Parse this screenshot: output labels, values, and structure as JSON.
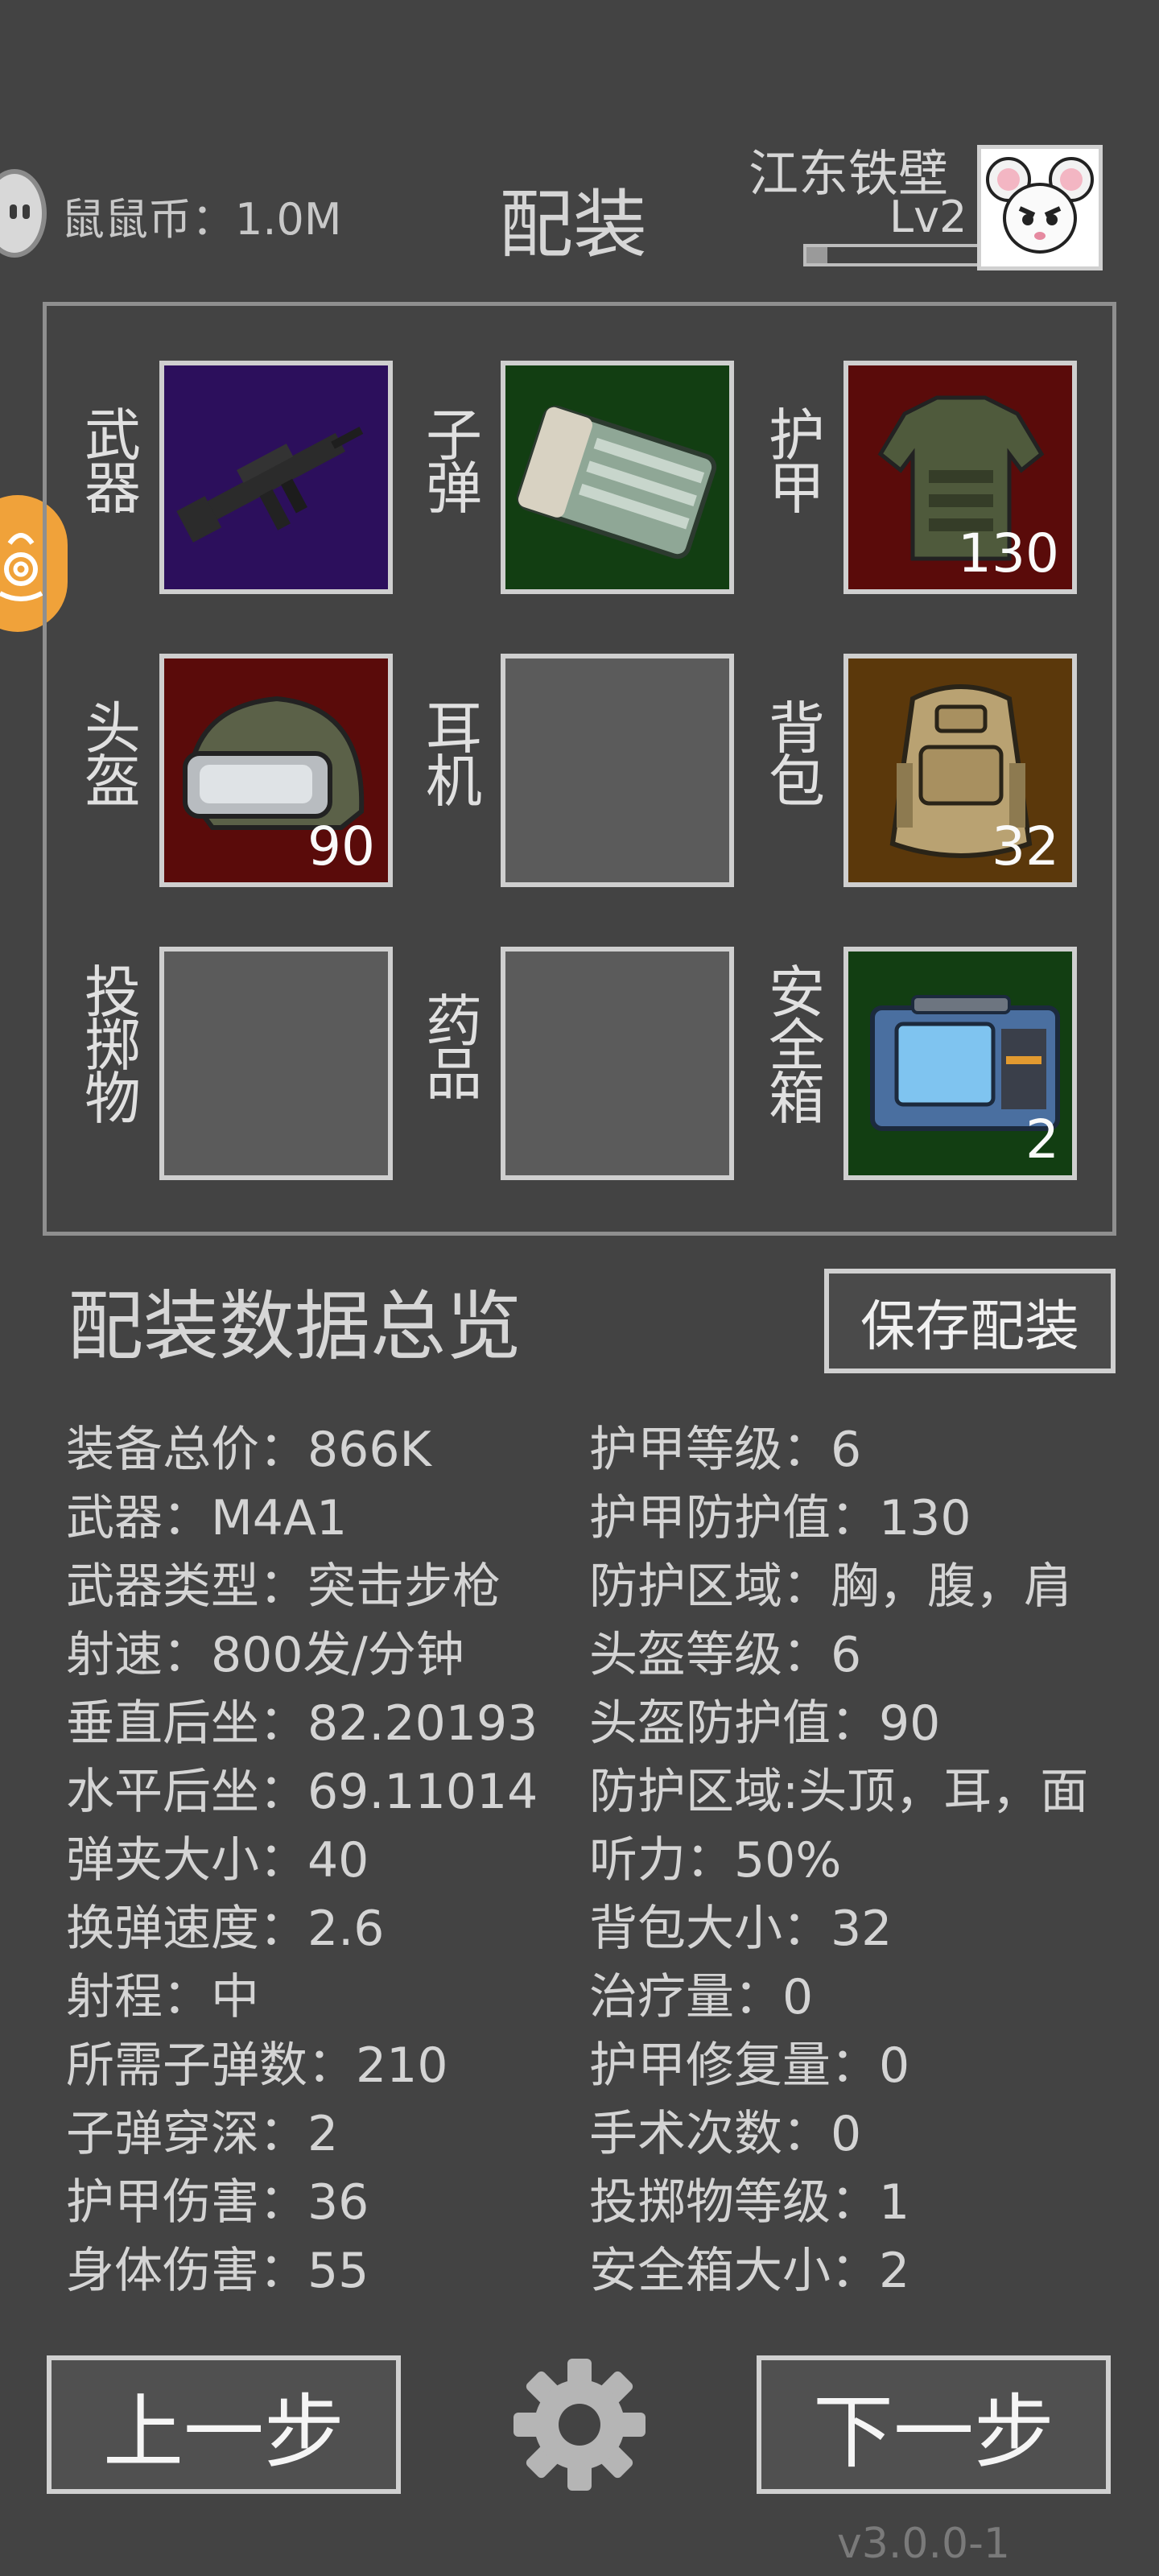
{
  "header": {
    "coins_label": "鼠鼠币：1.0M",
    "title": "配装",
    "username": "江东铁壁",
    "level": "Lv2",
    "xp_progress": 0.12
  },
  "slots": [
    {
      "label": "武器",
      "icon": "rifle-icon",
      "bg": "#2c0f5c",
      "count": ""
    },
    {
      "label": "子弹",
      "icon": "ammo-box-icon",
      "bg": "#123e12",
      "count": ""
    },
    {
      "label": "护甲",
      "icon": "armor-vest-icon",
      "bg": "#5a0b0a",
      "count": "130"
    },
    {
      "label": "头盔",
      "icon": "helmet-icon",
      "bg": "#5a0b0a",
      "count": "90"
    },
    {
      "label": "耳机",
      "icon": "",
      "bg": "#5b5b5b",
      "count": ""
    },
    {
      "label": "背包",
      "icon": "backpack-icon",
      "bg": "#5b380b",
      "count": "32"
    },
    {
      "label": "投掷物",
      "icon": "",
      "bg": "#5b5b5b",
      "count": ""
    },
    {
      "label": "药品",
      "icon": "",
      "bg": "#5b5b5b",
      "count": ""
    },
    {
      "label": "安全箱",
      "icon": "secure-case-icon",
      "bg": "#123e12",
      "count": "2"
    }
  ],
  "summary": {
    "title": "配装数据总览",
    "save_label": "保存配装",
    "left": [
      "装备总价：866K",
      "武器：M4A1",
      "武器类型：突击步枪",
      "射速：800发/分钟",
      "垂直后坐：82.20193",
      "水平后坐：69.11014",
      "弹夹大小：40",
      "换弹速度：2.6",
      "射程：中",
      "所需子弹数：210",
      "子弹穿深：2",
      "护甲伤害：36",
      "身体伤害：55"
    ],
    "right": [
      "护甲等级：6",
      "护甲防护值：130",
      "防护区域：胸，腹，肩",
      "头盔等级：6",
      "头盔防护值：90",
      "防护区域:头顶，耳，面",
      "听力：50%",
      "背包大小：32",
      "治疗量：0",
      "护甲修复量：0",
      "手术次数：0",
      "投掷物等级：1",
      "安全箱大小：2"
    ]
  },
  "footer": {
    "prev_label": "上一步",
    "next_label": "下一步",
    "version": "v3.0.0-1"
  }
}
